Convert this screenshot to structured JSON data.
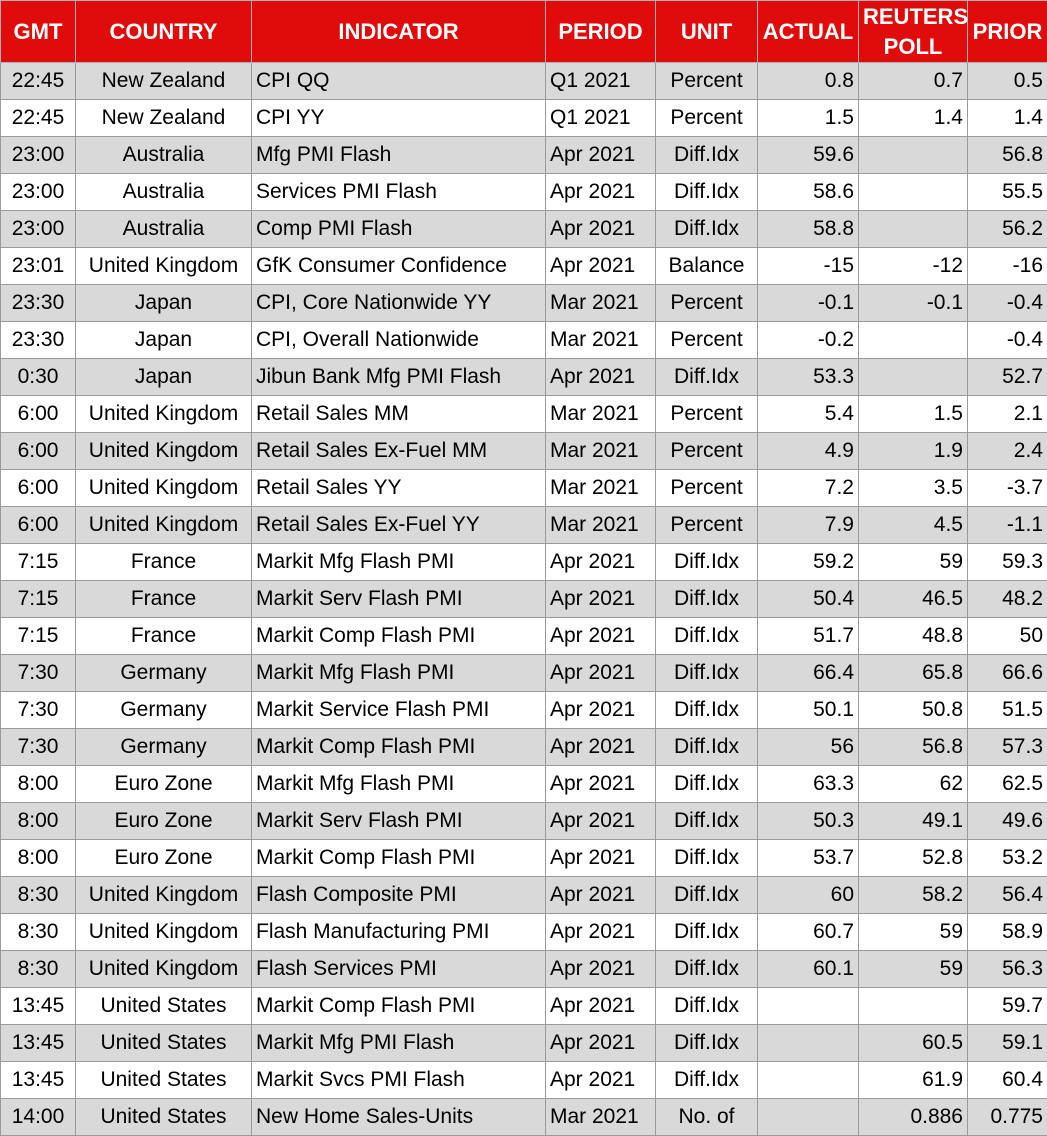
{
  "header": {
    "gmt": "GMT",
    "country": "COUNTRY",
    "indicator": "INDICATOR",
    "period": "PERIOD",
    "unit": "UNIT",
    "actual": "ACTUAL",
    "poll_line1": "REUTERS",
    "poll_line2": "POLL",
    "prior": "PRIOR"
  },
  "colors": {
    "header_bg": "#e00c0c",
    "header_text": "#ffffff",
    "shaded_row": "#d9d9d9"
  },
  "rows": [
    {
      "gmt": "22:45",
      "country": "New Zealand",
      "indicator": "CPI QQ",
      "period": "Q1 2021",
      "unit": "Percent",
      "actual": "0.8",
      "poll": "0.7",
      "prior": "0.5",
      "shaded": true
    },
    {
      "gmt": "22:45",
      "country": "New Zealand",
      "indicator": "CPI YY",
      "period": "Q1 2021",
      "unit": "Percent",
      "actual": "1.5",
      "poll": "1.4",
      "prior": "1.4",
      "shaded": false
    },
    {
      "gmt": "23:00",
      "country": "Australia",
      "indicator": "Mfg PMI Flash",
      "period": "Apr 2021",
      "unit": "Diff.Idx",
      "actual": "59.6",
      "poll": "",
      "prior": "56.8",
      "shaded": true
    },
    {
      "gmt": "23:00",
      "country": "Australia",
      "indicator": "Services PMI Flash",
      "period": "Apr 2021",
      "unit": "Diff.Idx",
      "actual": "58.6",
      "poll": "",
      "prior": "55.5",
      "shaded": false
    },
    {
      "gmt": "23:00",
      "country": "Australia",
      "indicator": "Comp PMI Flash",
      "period": "Apr 2021",
      "unit": "Diff.Idx",
      "actual": "58.8",
      "poll": "",
      "prior": "56.2",
      "shaded": true
    },
    {
      "gmt": "23:01",
      "country": "United Kingdom",
      "indicator": "GfK Consumer Confidence",
      "period": "Apr 2021",
      "unit": "Balance",
      "actual": "-15",
      "poll": "-12",
      "prior": "-16",
      "shaded": false
    },
    {
      "gmt": "23:30",
      "country": "Japan",
      "indicator": "CPI, Core Nationwide YY",
      "period": "Mar 2021",
      "unit": "Percent",
      "actual": "-0.1",
      "poll": "-0.1",
      "prior": "-0.4",
      "shaded": true
    },
    {
      "gmt": "23:30",
      "country": "Japan",
      "indicator": "CPI, Overall Nationwide",
      "period": "Mar 2021",
      "unit": "Percent",
      "actual": "-0.2",
      "poll": "",
      "prior": "-0.4",
      "shaded": false
    },
    {
      "gmt": "0:30",
      "country": "Japan",
      "indicator": "Jibun Bank Mfg PMI Flash",
      "period": "Apr 2021",
      "unit": "Diff.Idx",
      "actual": "53.3",
      "poll": "",
      "prior": "52.7",
      "shaded": true
    },
    {
      "gmt": "6:00",
      "country": "United Kingdom",
      "indicator": "Retail Sales MM",
      "period": "Mar 2021",
      "unit": "Percent",
      "actual": "5.4",
      "poll": "1.5",
      "prior": "2.1",
      "shaded": false
    },
    {
      "gmt": "6:00",
      "country": "United Kingdom",
      "indicator": "Retail Sales Ex-Fuel MM",
      "period": "Mar 2021",
      "unit": "Percent",
      "actual": "4.9",
      "poll": "1.9",
      "prior": "2.4",
      "shaded": true
    },
    {
      "gmt": "6:00",
      "country": "United Kingdom",
      "indicator": "Retail Sales YY",
      "period": "Mar 2021",
      "unit": "Percent",
      "actual": "7.2",
      "poll": "3.5",
      "prior": "-3.7",
      "shaded": false
    },
    {
      "gmt": "6:00",
      "country": "United Kingdom",
      "indicator": "Retail Sales Ex-Fuel YY",
      "period": "Mar 2021",
      "unit": "Percent",
      "actual": "7.9",
      "poll": "4.5",
      "prior": "-1.1",
      "shaded": true
    },
    {
      "gmt": "7:15",
      "country": "France",
      "indicator": "Markit Mfg Flash PMI",
      "period": "Apr 2021",
      "unit": "Diff.Idx",
      "actual": "59.2",
      "poll": "59",
      "prior": "59.3",
      "shaded": false
    },
    {
      "gmt": "7:15",
      "country": "France",
      "indicator": "Markit Serv Flash PMI",
      "period": "Apr 2021",
      "unit": "Diff.Idx",
      "actual": "50.4",
      "poll": "46.5",
      "prior": "48.2",
      "shaded": true
    },
    {
      "gmt": "7:15",
      "country": "France",
      "indicator": "Markit Comp Flash PMI",
      "period": "Apr 2021",
      "unit": "Diff.Idx",
      "actual": "51.7",
      "poll": "48.8",
      "prior": "50",
      "shaded": false
    },
    {
      "gmt": "7:30",
      "country": "Germany",
      "indicator": "Markit Mfg Flash PMI",
      "period": "Apr 2021",
      "unit": "Diff.Idx",
      "actual": "66.4",
      "poll": "65.8",
      "prior": "66.6",
      "shaded": true
    },
    {
      "gmt": "7:30",
      "country": "Germany",
      "indicator": "Markit Service Flash PMI",
      "period": "Apr 2021",
      "unit": "Diff.Idx",
      "actual": "50.1",
      "poll": "50.8",
      "prior": "51.5",
      "shaded": false
    },
    {
      "gmt": "7:30",
      "country": "Germany",
      "indicator": "Markit Comp Flash PMI",
      "period": "Apr 2021",
      "unit": "Diff.Idx",
      "actual": "56",
      "poll": "56.8",
      "prior": "57.3",
      "shaded": true
    },
    {
      "gmt": "8:00",
      "country": "Euro Zone",
      "indicator": "Markit Mfg Flash PMI",
      "period": "Apr 2021",
      "unit": "Diff.Idx",
      "actual": "63.3",
      "poll": "62",
      "prior": "62.5",
      "shaded": false
    },
    {
      "gmt": "8:00",
      "country": "Euro Zone",
      "indicator": "Markit Serv Flash PMI",
      "period": "Apr 2021",
      "unit": "Diff.Idx",
      "actual": "50.3",
      "poll": "49.1",
      "prior": "49.6",
      "shaded": true
    },
    {
      "gmt": "8:00",
      "country": "Euro Zone",
      "indicator": "Markit Comp Flash PMI",
      "period": "Apr 2021",
      "unit": "Diff.Idx",
      "actual": "53.7",
      "poll": "52.8",
      "prior": "53.2",
      "shaded": false
    },
    {
      "gmt": "8:30",
      "country": "United Kingdom",
      "indicator": "Flash Composite PMI",
      "period": "Apr 2021",
      "unit": "Diff.Idx",
      "actual": "60",
      "poll": "58.2",
      "prior": "56.4",
      "shaded": true
    },
    {
      "gmt": "8:30",
      "country": "United Kingdom",
      "indicator": "Flash Manufacturing PMI",
      "period": "Apr 2021",
      "unit": "Diff.Idx",
      "actual": "60.7",
      "poll": "59",
      "prior": "58.9",
      "shaded": false
    },
    {
      "gmt": "8:30",
      "country": "United Kingdom",
      "indicator": "Flash Services PMI",
      "period": "Apr 2021",
      "unit": "Diff.Idx",
      "actual": "60.1",
      "poll": "59",
      "prior": "56.3",
      "shaded": true
    },
    {
      "gmt": "13:45",
      "country": "United States",
      "indicator": "Markit Comp Flash PMI",
      "period": "Apr 2021",
      "unit": "Diff.Idx",
      "actual": "",
      "poll": "",
      "prior": "59.7",
      "shaded": false
    },
    {
      "gmt": "13:45",
      "country": "United States",
      "indicator": "Markit Mfg PMI Flash",
      "period": "Apr 2021",
      "unit": "Diff.Idx",
      "actual": "",
      "poll": "60.5",
      "prior": "59.1",
      "shaded": true
    },
    {
      "gmt": "13:45",
      "country": "United States",
      "indicator": "Markit Svcs PMI Flash",
      "period": "Apr 2021",
      "unit": "Diff.Idx",
      "actual": "",
      "poll": "61.9",
      "prior": "60.4",
      "shaded": false
    },
    {
      "gmt": "14:00",
      "country": "United States",
      "indicator": "New Home Sales-Units",
      "period": "Mar 2021",
      "unit": "No. of",
      "actual": "",
      "poll": "0.886",
      "prior": "0.775",
      "shaded": true
    }
  ]
}
